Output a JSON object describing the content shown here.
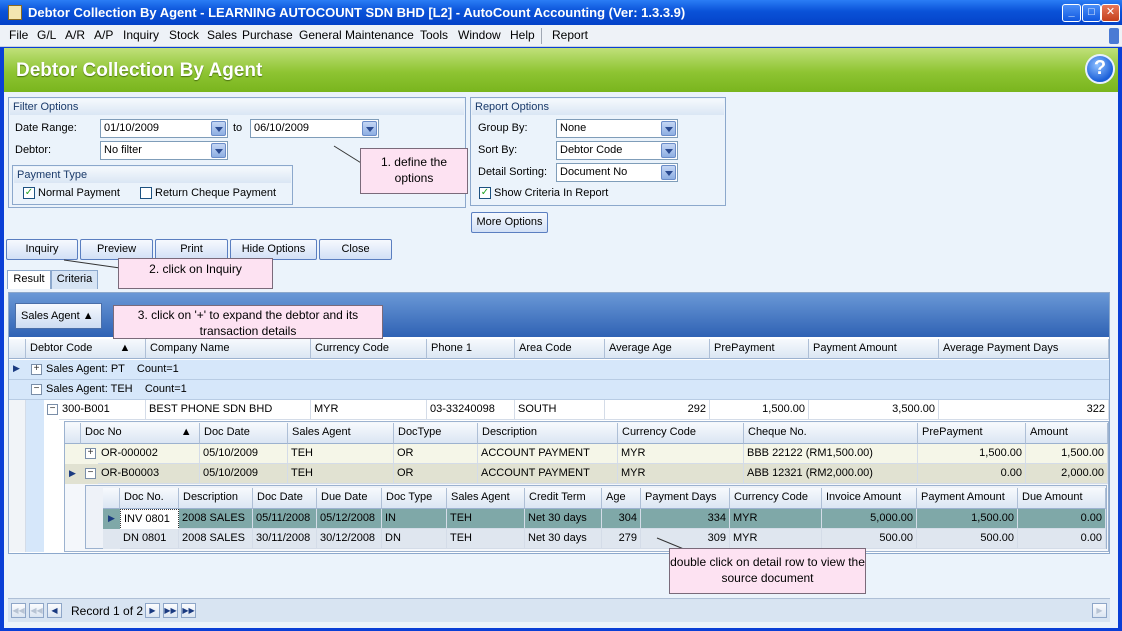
{
  "window": {
    "title": "Debtor Collection By Agent - LEARNING AUTOCOUNT SDN BHD [L2] - AutoCount Accounting (Ver: 1.3.3.9)",
    "min_glyph": "_",
    "max_glyph": "□",
    "close_glyph": "✕"
  },
  "menu": [
    "File",
    "G/L",
    "A/R",
    "A/P",
    "Inquiry",
    "Stock",
    "Sales",
    "Purchase",
    "General Maintenance",
    "Tools",
    "Window",
    "Help",
    "Report"
  ],
  "header": {
    "title": "Debtor Collection By Agent",
    "help_glyph": "?"
  },
  "filter": {
    "title": "Filter Options",
    "date_range_label": "Date Range:",
    "date_from": "01/10/2009",
    "to_label": "to",
    "date_to": "06/10/2009",
    "debtor_label": "Debtor:",
    "debtor_value": "No filter",
    "payment_type_title": "Payment Type",
    "normal_payment": "Normal Payment",
    "return_cheque": "Return Cheque Payment"
  },
  "report": {
    "title": "Report Options",
    "group_by_label": "Group By:",
    "group_by": "None",
    "sort_by_label": "Sort By:",
    "sort_by": "Debtor Code",
    "detail_sort_label": "Detail Sorting:",
    "detail_sort": "Document No",
    "show_criteria": "Show Criteria In Report",
    "more_options": "More Options"
  },
  "check_glyph": "✓",
  "buttons": [
    "Inquiry",
    "Preview",
    "Print",
    "Hide Options",
    "Close"
  ],
  "tabs": [
    "Result",
    "Criteria"
  ],
  "callouts": {
    "c1": "1. define the options",
    "c2": "2. click on Inquiry",
    "c3": "3. click on '+' to expand the debtor and its transaction details",
    "c4": "double click on detail row to view the source document"
  },
  "grid": {
    "group_panel": "Sales Agent",
    "columns": [
      "Debtor Code",
      "Company Name",
      "Currency Code",
      "Phone 1",
      "Area Code",
      "Average Age",
      "PrePayment",
      "Payment Amount",
      "Average Payment Days"
    ],
    "group1": "Sales Agent: PT    Count=1",
    "group2": "Sales Agent: TEH    Count=1",
    "debtor": [
      "300-B001",
      "BEST PHONE SDN BHD",
      "MYR",
      "03-33240098",
      "SOUTH",
      "292",
      "1,500.00",
      "3,500.00",
      "322"
    ],
    "sub_columns": [
      "Doc No",
      "Doc Date",
      "Sales Agent",
      "DocType",
      "Description",
      "Currency Code",
      "Cheque No.",
      "PrePayment",
      "Amount"
    ],
    "sub_rows": [
      [
        "OR-000002",
        "05/10/2009",
        "TEH",
        "OR",
        "ACCOUNT PAYMENT",
        "MYR",
        "BBB 22122 (RM1,500.00)",
        "1,500.00",
        "1,500.00"
      ],
      [
        "OR-B00003",
        "05/10/2009",
        "TEH",
        "OR",
        "ACCOUNT PAYMENT",
        "MYR",
        "ABB 12321 (RM2,000.00)",
        "0.00",
        "2,000.00"
      ]
    ],
    "detail_columns": [
      "Doc No.",
      "Description",
      "Doc Date",
      "Due Date",
      "Doc Type",
      "Sales Agent",
      "Credit Term",
      "Age",
      "Payment Days",
      "Currency Code",
      "Invoice Amount",
      "Payment Amount",
      "Due Amount"
    ],
    "detail_rows": [
      [
        "INV 0801",
        "2008 SALES",
        "05/11/2008",
        "05/12/2008",
        "IN",
        "TEH",
        "Net 30 days",
        "304",
        "334",
        "MYR",
        "5,000.00",
        "1,500.00",
        "0.00"
      ],
      [
        "DN 0801",
        "2008 SALES",
        "30/11/2008",
        "30/12/2008",
        "DN",
        "TEH",
        "Net 30 days",
        "279",
        "309",
        "MYR",
        "500.00",
        "500.00",
        "0.00"
      ]
    ],
    "record_label": "Record 1 of 2",
    "plus": "+",
    "minus": "−"
  },
  "colors": {
    "accent_green": "#8ec432",
    "title_blue": "#0a52d8",
    "selected_row": "#7fa8a8",
    "callout": "#fde2f2"
  }
}
